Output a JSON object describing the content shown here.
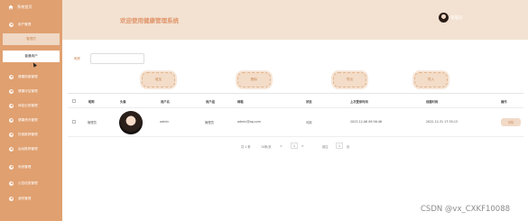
{
  "sidebar": {
    "home_label": "系统首页",
    "groups": [
      {
        "label": "用户管理"
      },
      {
        "label": "健康档案管理"
      },
      {
        "label": "健康评估管理"
      },
      {
        "label": "体检记录管理"
      },
      {
        "label": "健康资讯管理"
      },
      {
        "label": "饮食推荐管理"
      },
      {
        "label": "运动推荐管理"
      },
      {
        "label": "系统管理"
      },
      {
        "label": "公告信息管理"
      },
      {
        "label": "我的管理"
      }
    ],
    "sub_items": [
      {
        "label": "管理员"
      },
      {
        "label": "普通用户"
      }
    ]
  },
  "header": {
    "title": "欢迎使用健康管理系统",
    "user": "管理员"
  },
  "search": {
    "label": "昵称",
    "value": ""
  },
  "toolbar": {
    "add": "增加",
    "delete": "删除",
    "export": "导出",
    "import": "导入"
  },
  "table": {
    "headers": [
      "昵称",
      "头像",
      "用户名",
      "用户组",
      "邮箱",
      "状态",
      "上次登录时间",
      "创建时间",
      "操作"
    ],
    "rows": [
      {
        "nickname": "管理员",
        "username": "admin",
        "group": "管理员",
        "email": "admin@qq.com",
        "status": "可用",
        "last_login": "2023-12-06 09:56:46",
        "created": "2022-12-31 17:35:13",
        "action": "详情"
      }
    ]
  },
  "pagination": {
    "total": "共 1 条",
    "page_size": "10条/页",
    "prev": "<",
    "current": "1",
    "next": ">",
    "goto": "前往",
    "goto_value": "1",
    "unit": "页"
  },
  "watermark": "CSDN @vx_CXKF10088",
  "colors": {
    "sidebar": "#e0a070",
    "header": "#f3e2d2",
    "accent": "#e0956a"
  }
}
